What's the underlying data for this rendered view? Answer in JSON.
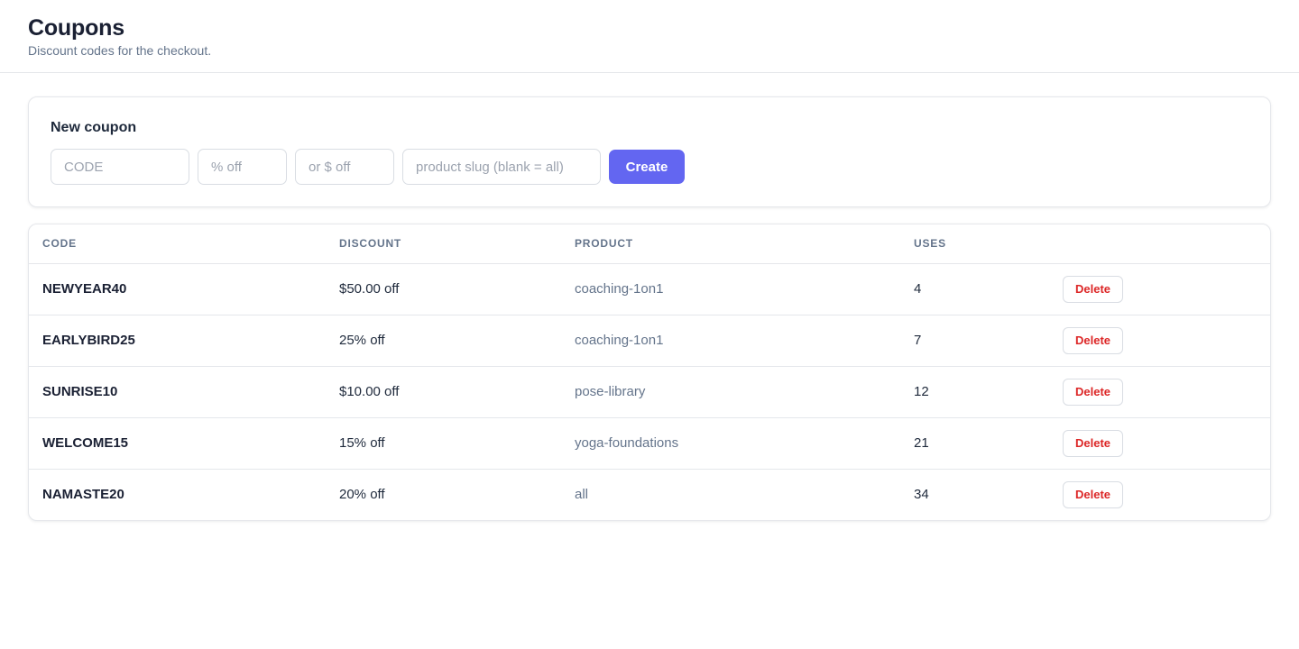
{
  "header": {
    "title": "Coupons",
    "subtitle": "Discount codes for the checkout."
  },
  "new_coupon": {
    "title": "New coupon",
    "code_placeholder": "CODE",
    "percent_placeholder": "% off",
    "amount_placeholder": "or $ off",
    "product_placeholder": "product slug (blank = all)",
    "create_label": "Create"
  },
  "table": {
    "columns": [
      "CODE",
      "DISCOUNT",
      "PRODUCT",
      "USES",
      ""
    ],
    "delete_label": "Delete",
    "rows": [
      {
        "code": "NEWYEAR40",
        "discount": "$50.00 off",
        "product": "coaching-1on1",
        "uses": "4"
      },
      {
        "code": "EARLYBIRD25",
        "discount": "25% off",
        "product": "coaching-1on1",
        "uses": "7"
      },
      {
        "code": "SUNRISE10",
        "discount": "$10.00 off",
        "product": "pose-library",
        "uses": "12"
      },
      {
        "code": "WELCOME15",
        "discount": "15% off",
        "product": "yoga-foundations",
        "uses": "21"
      },
      {
        "code": "NAMASTE20",
        "discount": "20% off",
        "product": "all",
        "uses": "34"
      }
    ]
  },
  "colors": {
    "accent": "#6366f1",
    "danger": "#dc2626"
  }
}
